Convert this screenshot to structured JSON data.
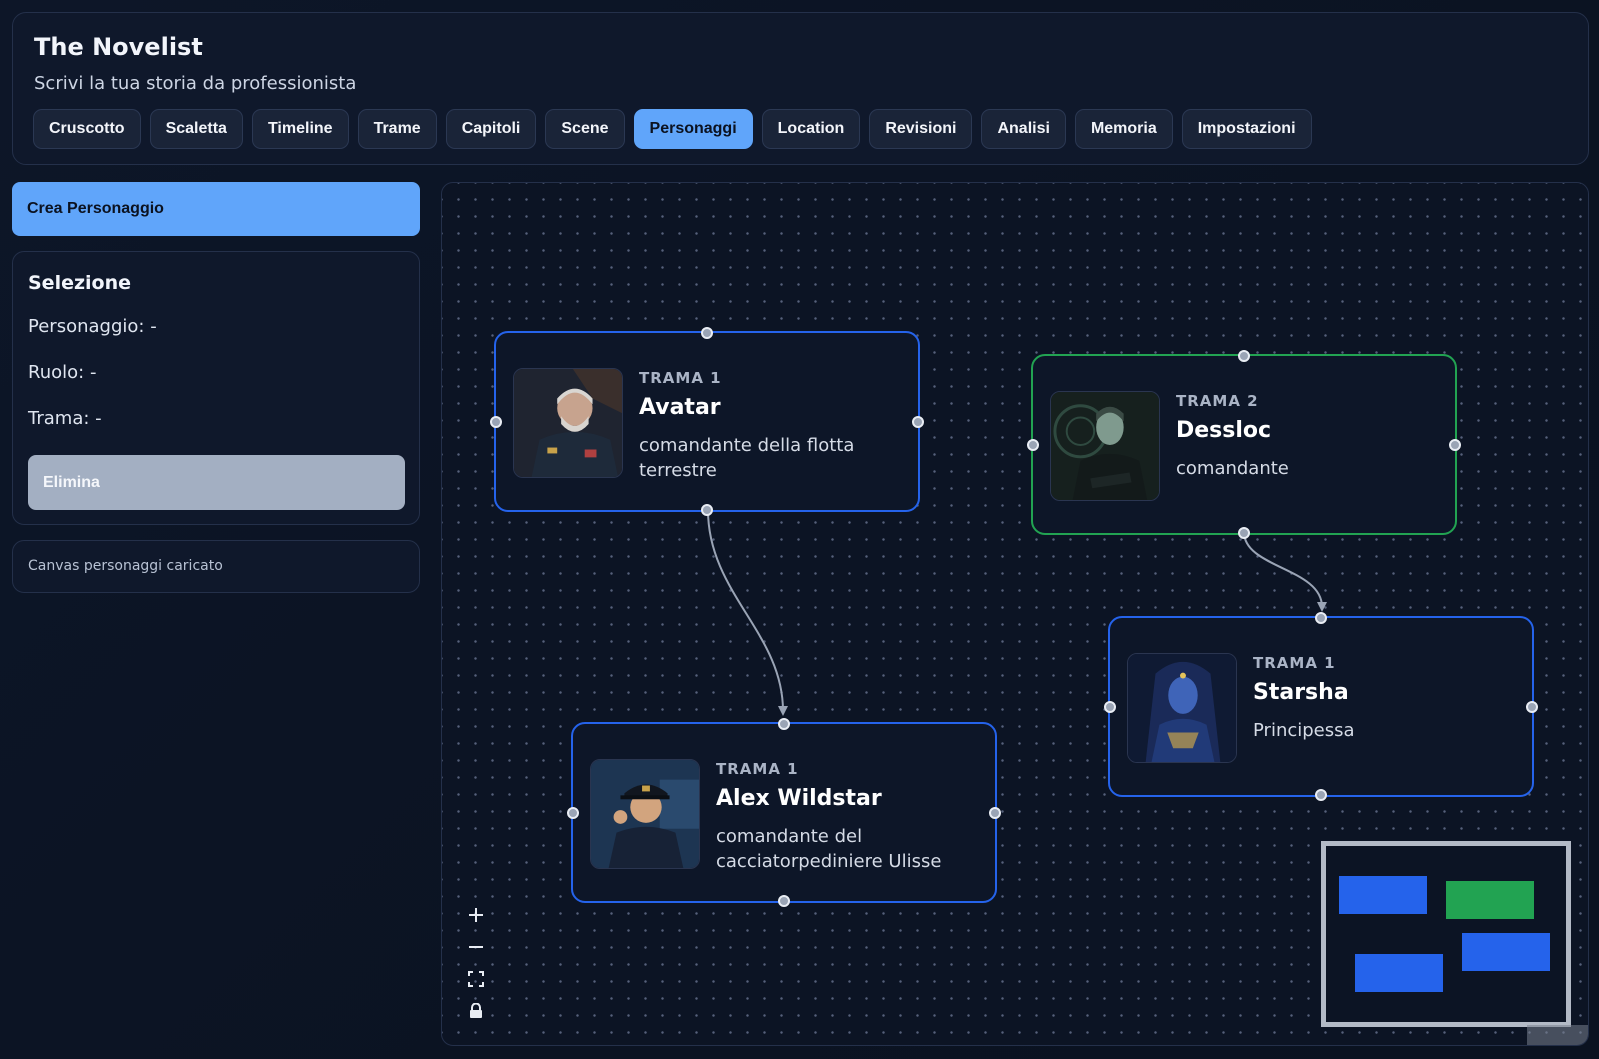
{
  "app": {
    "title": "The Novelist",
    "subtitle": "Scrivi la tua storia da professionista"
  },
  "nav": {
    "tabs": [
      {
        "label": "Cruscotto",
        "active": false
      },
      {
        "label": "Scaletta",
        "active": false
      },
      {
        "label": "Timeline",
        "active": false
      },
      {
        "label": "Trame",
        "active": false
      },
      {
        "label": "Capitoli",
        "active": false
      },
      {
        "label": "Scene",
        "active": false
      },
      {
        "label": "Personaggi",
        "active": true
      },
      {
        "label": "Location",
        "active": false
      },
      {
        "label": "Revisioni",
        "active": false
      },
      {
        "label": "Analisi",
        "active": false
      },
      {
        "label": "Memoria",
        "active": false
      },
      {
        "label": "Impostazioni",
        "active": false
      }
    ]
  },
  "sidebar": {
    "create_label": "Crea Personaggio",
    "selection": {
      "title": "Selezione",
      "character_label": "Personaggio:",
      "character_value": "-",
      "role_label": "Ruolo:",
      "role_value": "-",
      "plot_label": "Trama:",
      "plot_value": "-",
      "delete_label": "Elimina"
    },
    "status_text": "Canvas personaggi caricato"
  },
  "canvas": {
    "nodes": [
      {
        "plot": "TRAMA 1",
        "name": "Avatar",
        "role": "comandante della flotta terrestre",
        "color": "#2563eb"
      },
      {
        "plot": "TRAMA 2",
        "name": "Dessloc",
        "role": "comandante",
        "color": "#22a352"
      },
      {
        "plot": "TRAMA 1",
        "name": "Alex Wildstar",
        "role": "comandante del cacciatorpediniere Ulisse",
        "color": "#2563eb"
      },
      {
        "plot": "TRAMA 1",
        "name": "Starsha",
        "role": "Principessa",
        "color": "#2563eb"
      }
    ],
    "controls": {
      "zoom_in_icon": "plus-icon",
      "zoom_out_icon": "minus-icon",
      "fit_view_icon": "fit-view-icon",
      "lock_icon": "lock-icon"
    },
    "colors": {
      "accent": "#60a5fa",
      "plot1": "#2563eb",
      "plot2": "#22a352",
      "edge": "#9aa4b5"
    }
  }
}
